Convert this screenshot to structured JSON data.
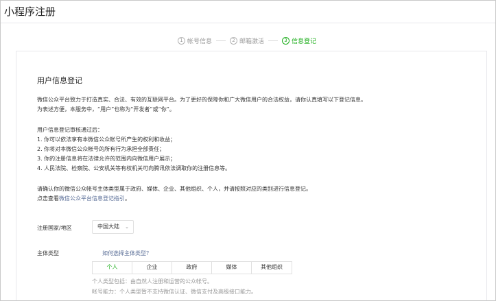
{
  "page": {
    "title": "小程序注册"
  },
  "steps": [
    {
      "num": "1",
      "label": "帐号信息",
      "active": false
    },
    {
      "num": "2",
      "label": "邮箱激活",
      "active": false
    },
    {
      "num": "3",
      "label": "信息登记",
      "active": true
    }
  ],
  "section": {
    "title": "用户信息登记"
  },
  "intro": {
    "line1": "微信公众平台致力于打造真实、合法、有效的互联网平台。为了更好的保障你和广大微信用户的合法权益，请你认真填写以下登记信息。",
    "line2": "为表述方便，本服务中，“用户”也称为“开发者”或“你”。"
  },
  "rules": {
    "intro": "用户信息登记审核通过后：",
    "items": [
      "1. 你可以依法享有本微信公众帐号所产生的权利和收益；",
      "2. 你将对本微信公众帐号的所有行为承担全部责任；",
      "3. 你的注册信息将在法律允许的范围内向微信用户展示；",
      "4. 人民法院、检察院、公安机关等有权机关可向腾讯依法调取你的注册信息等。"
    ]
  },
  "notice": {
    "line1": "请确认你的微信公众帐号主体类型属于政府、媒体、企业、其他组织、个人，并请按照对应的类别进行信息登记。",
    "line2_prefix": "点击查看",
    "line2_link": "微信公众平台信息登记指引",
    "line2_suffix": "。"
  },
  "form": {
    "region": {
      "label": "注册国家/地区",
      "value": "中国大陆"
    },
    "entity_type": {
      "label": "主体类型",
      "help_link": "如何选择主体类型？",
      "tabs": [
        "个人",
        "企业",
        "政府",
        "媒体",
        "其他组织"
      ],
      "selected": "个人",
      "desc1": "个人类型包括：由自然人注册和运营的公众帐号。",
      "desc2": "帐号能力：个人类型暂不支持微信认证、微信支付及高级接口能力。"
    }
  },
  "colors": {
    "accent": "#1aad19",
    "link": "#576b95",
    "text": "#353535",
    "muted": "#9a9a9a",
    "border": "#e7e7eb"
  },
  "icons": {
    "region_chevron": "chevron-down-icon"
  }
}
